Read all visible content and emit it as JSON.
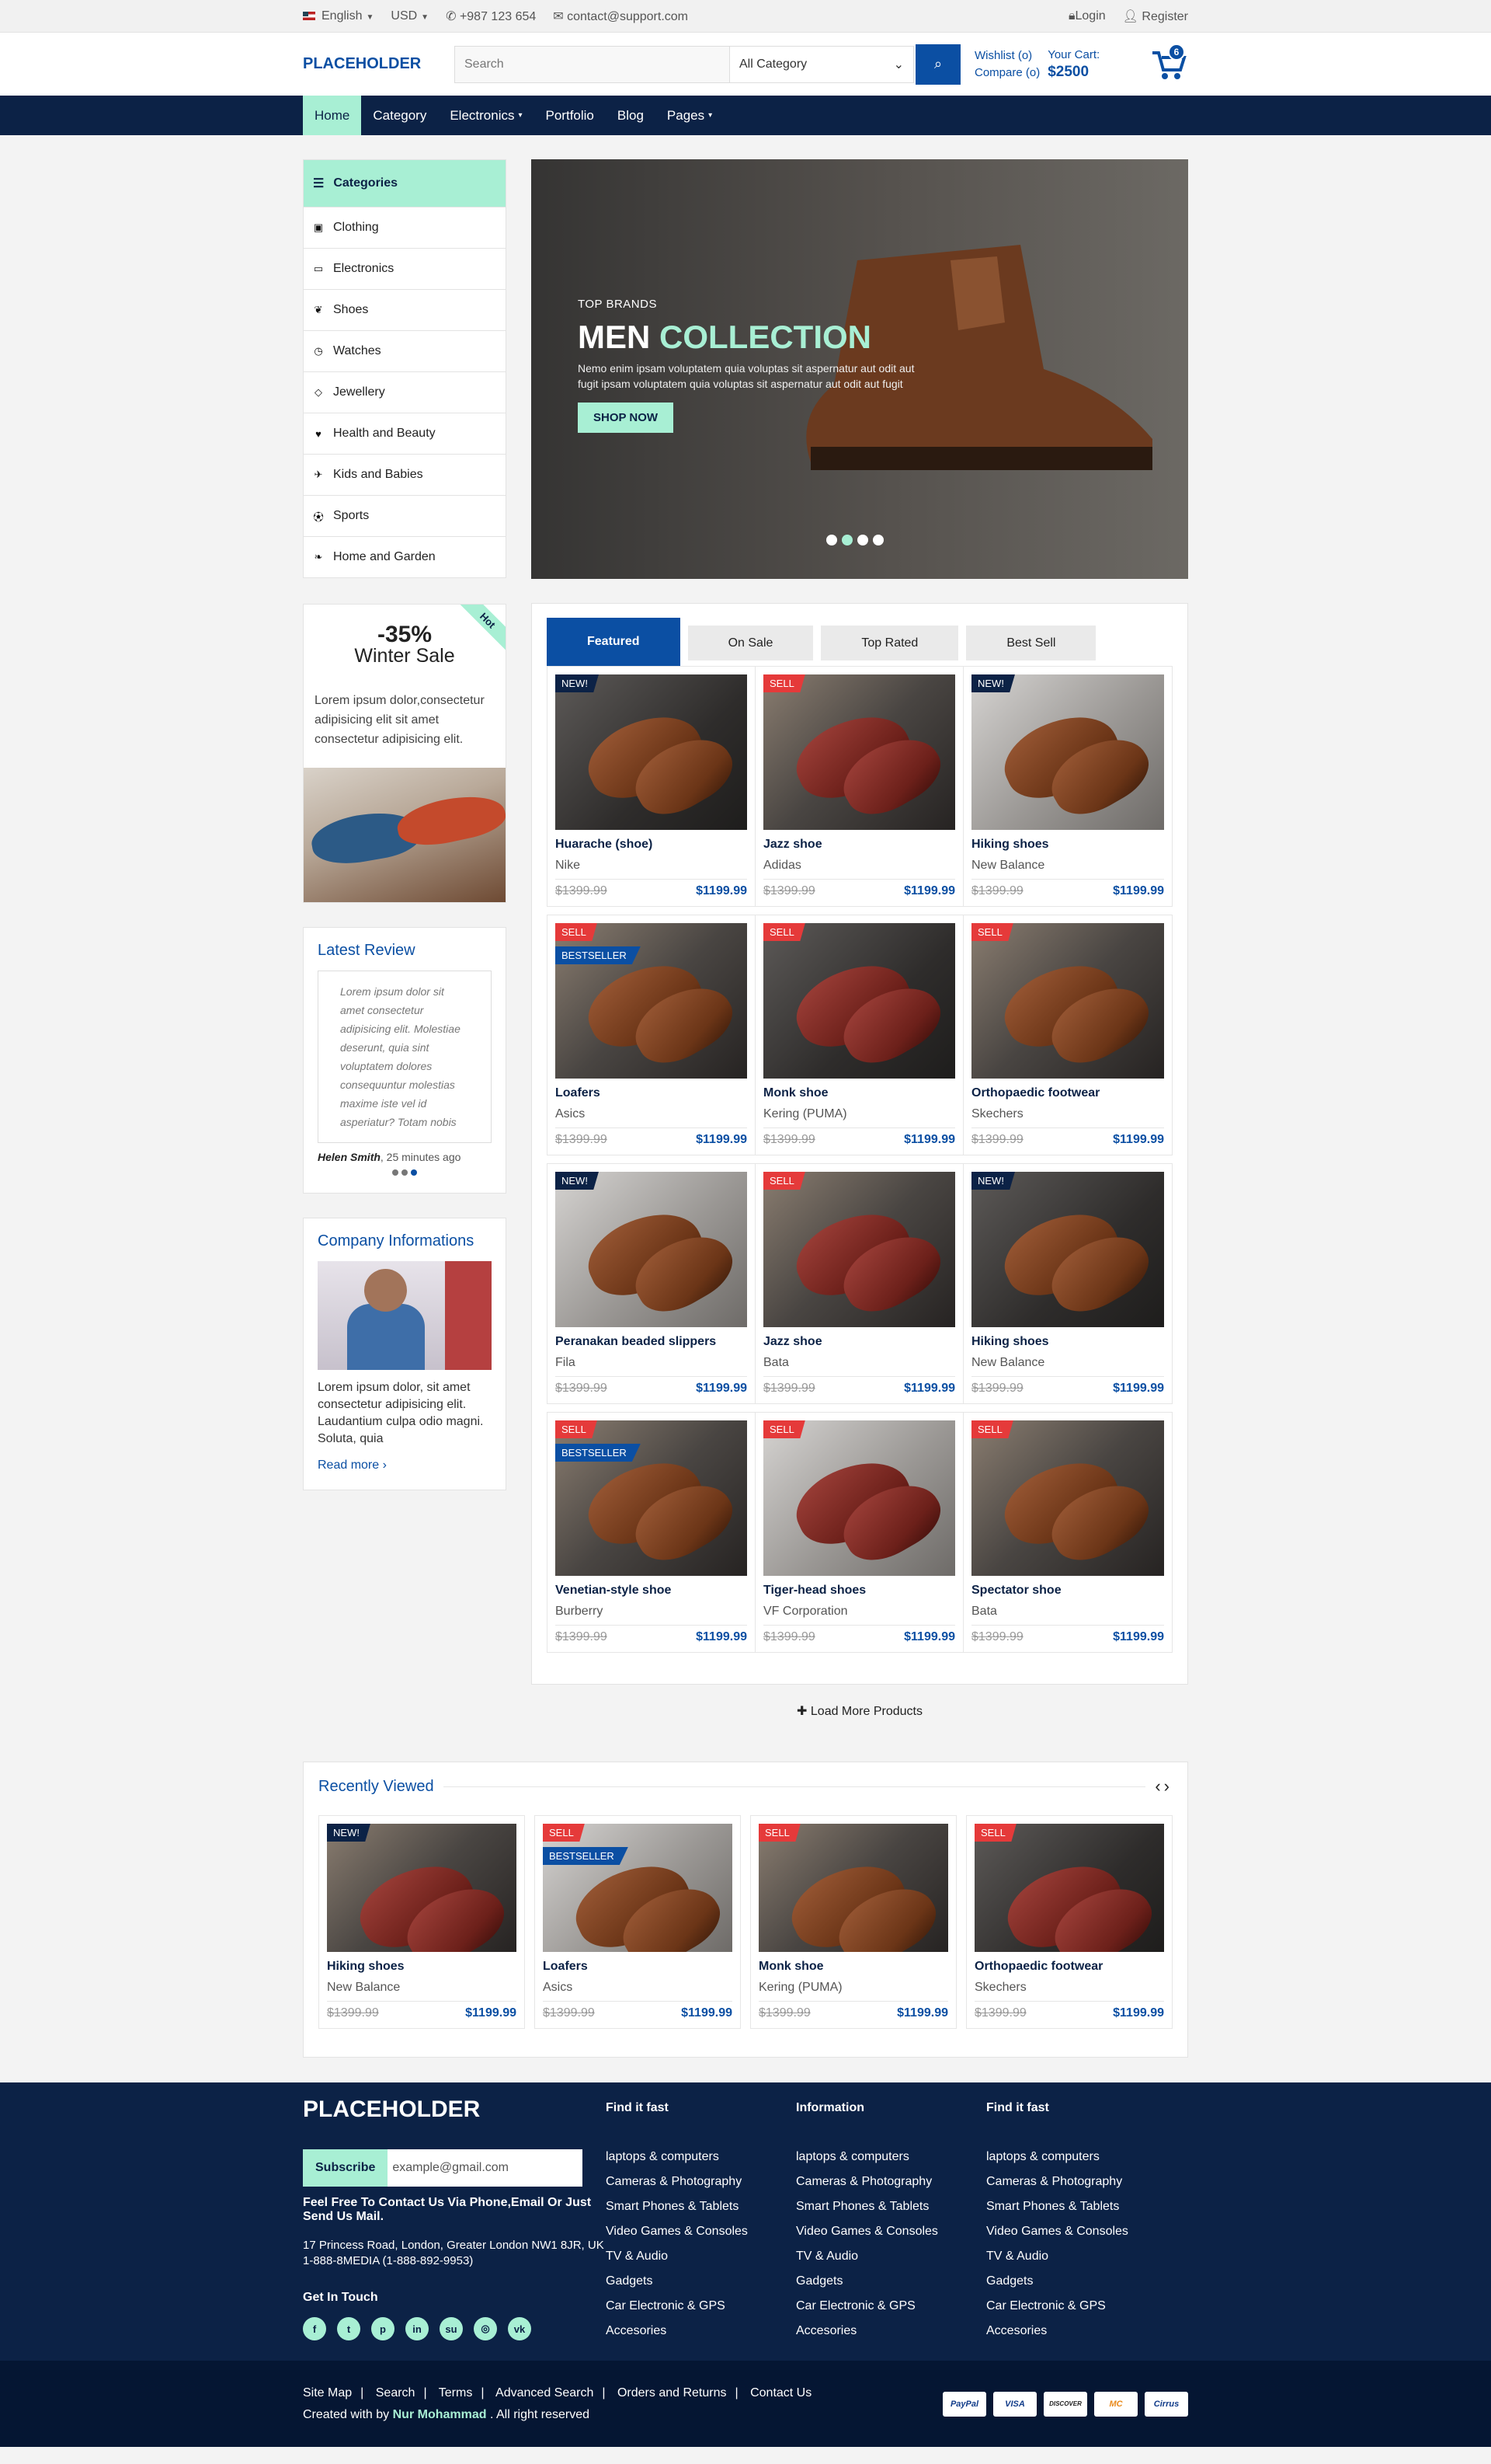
{
  "topbar": {
    "language": "English",
    "currency": "USD",
    "phone": "+987 123 654",
    "email": "contact@support.com",
    "login": "Login",
    "register": "Register"
  },
  "header": {
    "logo": "PLACEHOLDER",
    "search_placeholder": "Search",
    "category": "All Category",
    "wishlist": "Wishlist (o)",
    "compare": "Compare (o)",
    "cart_label": "Your Cart:",
    "cart_total": "$2500",
    "cart_count": "6"
  },
  "nav": [
    "Home",
    "Category",
    "Electronics",
    "Portfolio",
    "Blog",
    "Pages"
  ],
  "categories": {
    "title": "Categories",
    "items": [
      "Clothing",
      "Electronics",
      "Shoes",
      "Watches",
      "Jewellery",
      "Health and Beauty",
      "Kids and Babies",
      "Sports",
      "Home and Garden"
    ]
  },
  "sale": {
    "hot": "Hot",
    "percent": "-35%",
    "title": "Winter Sale",
    "desc": "Lorem ipsum dolor,consectetur adipisicing elit sit amet consectetur adipisicing elit."
  },
  "review": {
    "title": "Latest Review",
    "text": "Lorem ipsum dolor sit amet consectetur adipisicing elit. Molestiae deserunt, quia sint voluptatem dolores consequuntur molestias maxime iste vel id asperiatur? Totam nobis",
    "author": "Helen Smith",
    "time": ", 25 minutes ago"
  },
  "company": {
    "title": "Company Informations",
    "text": "Lorem ipsum dolor, sit amet consectetur adipisicing elit. Laudantium culpa odio magni. Soluta, quia",
    "read_more": "Read more ›"
  },
  "slider": {
    "kicker": "TOP BRANDS",
    "title_a": "MEN",
    "title_b": "COLLECTION",
    "desc": "Nemo enim ipsam voluptatem quia voluptas sit aspernatur aut odit aut fugit ipsam voluptatem quia voluptas sit aspernatur aut odit aut fugit",
    "button": "SHOP NOW"
  },
  "tabs": [
    "Featured",
    "On Sale",
    "Top Rated",
    "Best Sell"
  ],
  "products": [
    [
      {
        "badge": "NEW!",
        "type": "new",
        "name": "Huarache (shoe)",
        "brand": "Nike",
        "old": "$1399.99",
        "price": "$1199.99"
      },
      {
        "badge": "SELL",
        "type": "sell",
        "name": "Jazz shoe",
        "brand": "Adidas",
        "old": "$1399.99",
        "price": "$1199.99"
      },
      {
        "badge": "NEW!",
        "type": "new",
        "name": "Hiking shoes",
        "brand": "New Balance",
        "old": "$1399.99",
        "price": "$1199.99"
      }
    ],
    [
      {
        "badge": "SELL",
        "type": "sell",
        "badge2": "BESTSELLER",
        "name": "Loafers",
        "brand": "Asics",
        "old": "$1399.99",
        "price": "$1199.99"
      },
      {
        "badge": "SELL",
        "type": "sell",
        "name": "Monk shoe",
        "brand": "Kering (PUMA)",
        "old": "$1399.99",
        "price": "$1199.99"
      },
      {
        "badge": "SELL",
        "type": "sell",
        "name": "Orthopaedic footwear",
        "brand": "Skechers",
        "old": "$1399.99",
        "price": "$1199.99"
      }
    ],
    [
      {
        "badge": "NEW!",
        "type": "new",
        "name": "Peranakan beaded slippers",
        "brand": "Fila",
        "old": "$1399.99",
        "price": "$1199.99"
      },
      {
        "badge": "SELL",
        "type": "sell",
        "name": "Jazz shoe",
        "brand": "Bata",
        "old": "$1399.99",
        "price": "$1199.99"
      },
      {
        "badge": "NEW!",
        "type": "new",
        "name": "Hiking shoes",
        "brand": "New Balance",
        "old": "$1399.99",
        "price": "$1199.99"
      }
    ],
    [
      {
        "badge": "SELL",
        "type": "sell",
        "badge2": "BESTSELLER",
        "name": "Venetian-style shoe",
        "brand": "Burberry",
        "old": "$1399.99",
        "price": "$1199.99"
      },
      {
        "badge": "SELL",
        "type": "sell",
        "name": "Tiger-head shoes",
        "brand": "VF Corporation",
        "old": "$1399.99",
        "price": "$1199.99"
      },
      {
        "badge": "SELL",
        "type": "sell",
        "name": "Spectator shoe",
        "brand": "Bata",
        "old": "$1399.99",
        "price": "$1199.99"
      }
    ]
  ],
  "load_more": "Load More Products",
  "recent": {
    "title": "Recently Viewed",
    "items": [
      {
        "badge": "NEW!",
        "type": "new",
        "name": "Hiking shoes",
        "brand": "New Balance",
        "old": "$1399.99",
        "price": "$1199.99"
      },
      {
        "badge": "SELL",
        "type": "sell",
        "badge2": "BESTSELLER",
        "name": "Loafers",
        "brand": "Asics",
        "old": "$1399.99",
        "price": "$1199.99"
      },
      {
        "badge": "SELL",
        "type": "sell",
        "name": "Monk shoe",
        "brand": "Kering (PUMA)",
        "old": "$1399.99",
        "price": "$1199.99"
      },
      {
        "badge": "SELL",
        "type": "sell",
        "name": "Orthopaedic footwear",
        "brand": "Skechers",
        "old": "$1399.99",
        "price": "$1199.99"
      }
    ]
  },
  "footer": {
    "logo": "PLACEHOLDER",
    "subscribe": "Subscribe",
    "email_placeholder": "example@gmail.com",
    "contact_note": "Feel Free To Contact Us Via Phone,Email Or Just Send Us Mail.",
    "address": "17 Princess Road, London, Greater London NW1 8JR, UK 1-888-8MEDIA (1-888-892-9953)",
    "get_in_touch": "Get In Touch",
    "columns": [
      {
        "title": "Find it fast",
        "links": [
          "laptops & computers",
          "Cameras & Photography",
          "Smart Phones & Tablets",
          "Video Games & Consoles",
          "TV & Audio",
          "Gadgets",
          "Car Electronic & GPS",
          "Accesories"
        ]
      },
      {
        "title": "Information",
        "links": [
          "laptops & computers",
          "Cameras & Photography",
          "Smart Phones & Tablets",
          "Video Games & Consoles",
          "TV & Audio",
          "Gadgets",
          "Car Electronic & GPS",
          "Accesories"
        ]
      },
      {
        "title": "Find it fast",
        "links": [
          "laptops & computers",
          "Cameras & Photography",
          "Smart Phones & Tablets",
          "Video Games & Consoles",
          "TV & Audio",
          "Gadgets",
          "Car Electronic & GPS",
          "Accesories"
        ]
      }
    ]
  },
  "bottom": {
    "links": [
      "Site Map",
      "Search",
      "Terms",
      "Advanced Search",
      "Orders and Returns",
      "Contact Us"
    ],
    "created_by": "Created with by",
    "author": "Nur Mohammad",
    "rights": ". All right reserved",
    "payments": [
      "PayPal",
      "VISA",
      "DISCOVER",
      "MC",
      "Cirrus"
    ]
  },
  "colors": {
    "primary": "#0b4fa3",
    "accent": "#a8efd4",
    "navy": "#0c2246",
    "sale": "#e53a3a"
  }
}
